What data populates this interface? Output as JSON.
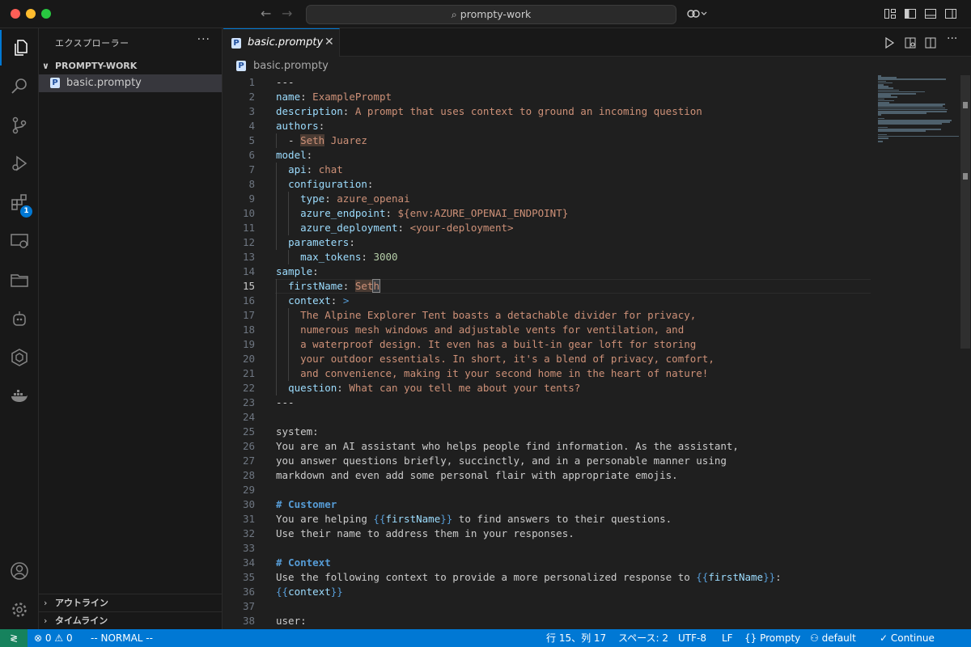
{
  "window": {
    "search_text": "prompty-work"
  },
  "activity": {
    "extensions_badge": "1"
  },
  "sidebar": {
    "title": "エクスプローラー",
    "more": "···",
    "folder_name": "PROMPTY-WORK",
    "file_name": "basic.prompty",
    "outline_label": "アウトライン",
    "timeline_label": "タイムライン"
  },
  "editor": {
    "tab_label": "basic.prompty",
    "breadcrumb": "basic.prompty",
    "current_line": "15"
  },
  "statusbar": {
    "problems_errors": "0",
    "problems_warnings": "0",
    "mode": "-- NORMAL --",
    "position": "行 15、列 17",
    "spaces": "スペース: 2",
    "encoding": "UTF-8",
    "eol": "LF",
    "language": "Prompty",
    "profile": "default",
    "continue": "Continue"
  },
  "code_lines": [
    {
      "n": "1",
      "segs": [
        [
          "p",
          "---"
        ]
      ]
    },
    {
      "n": "2",
      "segs": [
        [
          "k",
          "name"
        ],
        [
          "p",
          ": "
        ],
        [
          "s",
          "ExamplePrompt"
        ]
      ]
    },
    {
      "n": "3",
      "segs": [
        [
          "k",
          "description"
        ],
        [
          "p",
          ": "
        ],
        [
          "s",
          "A prompt that uses context to ground an incoming question"
        ]
      ]
    },
    {
      "n": "4",
      "segs": [
        [
          "k",
          "authors"
        ],
        [
          "p",
          ":"
        ]
      ]
    },
    {
      "n": "5",
      "segs": [
        [
          "p",
          "  - "
        ],
        [
          "hl",
          "Seth"
        ],
        [
          "s",
          " Juarez"
        ]
      ]
    },
    {
      "n": "6",
      "segs": [
        [
          "k",
          "model"
        ],
        [
          "p",
          ":"
        ]
      ]
    },
    {
      "n": "7",
      "segs": [
        [
          "p",
          "  "
        ],
        [
          "k",
          "api"
        ],
        [
          "p",
          ": "
        ],
        [
          "s",
          "chat"
        ]
      ]
    },
    {
      "n": "8",
      "segs": [
        [
          "p",
          "  "
        ],
        [
          "k",
          "configuration"
        ],
        [
          "p",
          ":"
        ]
      ]
    },
    {
      "n": "9",
      "segs": [
        [
          "p",
          "    "
        ],
        [
          "k",
          "type"
        ],
        [
          "p",
          ": "
        ],
        [
          "s",
          "azure_openai"
        ]
      ]
    },
    {
      "n": "10",
      "segs": [
        [
          "p",
          "    "
        ],
        [
          "k",
          "azure_endpoint"
        ],
        [
          "p",
          ": "
        ],
        [
          "s",
          "${env:AZURE_OPENAI_ENDPOINT}"
        ]
      ]
    },
    {
      "n": "11",
      "segs": [
        [
          "p",
          "    "
        ],
        [
          "k",
          "azure_deployment"
        ],
        [
          "p",
          ": "
        ],
        [
          "s",
          "<your-deployment>"
        ]
      ]
    },
    {
      "n": "12",
      "segs": [
        [
          "p",
          "  "
        ],
        [
          "k",
          "parameters"
        ],
        [
          "p",
          ":"
        ]
      ]
    },
    {
      "n": "13",
      "segs": [
        [
          "p",
          "    "
        ],
        [
          "k",
          "max_tokens"
        ],
        [
          "p",
          ": "
        ],
        [
          "n",
          "3000"
        ]
      ]
    },
    {
      "n": "14",
      "segs": [
        [
          "k",
          "sample"
        ],
        [
          "p",
          ":"
        ]
      ]
    },
    {
      "n": "15",
      "segs": [
        [
          "p",
          "  "
        ],
        [
          "k",
          "firstName"
        ],
        [
          "p",
          ": "
        ],
        [
          "hl",
          "Set"
        ],
        [
          "cur",
          "h"
        ]
      ]
    },
    {
      "n": "16",
      "segs": [
        [
          "p",
          "  "
        ],
        [
          "k",
          "context"
        ],
        [
          "p",
          ": "
        ],
        [
          "v",
          ">"
        ]
      ]
    },
    {
      "n": "17",
      "segs": [
        [
          "p",
          "    "
        ],
        [
          "s",
          "The Alpine Explorer Tent boasts a detachable divider for privacy,"
        ]
      ]
    },
    {
      "n": "18",
      "segs": [
        [
          "p",
          "    "
        ],
        [
          "s",
          "numerous mesh windows and adjustable vents for ventilation, and"
        ]
      ]
    },
    {
      "n": "19",
      "segs": [
        [
          "p",
          "    "
        ],
        [
          "s",
          "a waterproof design. It even has a built-in gear loft for storing"
        ]
      ]
    },
    {
      "n": "20",
      "segs": [
        [
          "p",
          "    "
        ],
        [
          "s",
          "your outdoor essentials. In short, it's a blend of privacy, comfort,"
        ]
      ]
    },
    {
      "n": "21",
      "segs": [
        [
          "p",
          "    "
        ],
        [
          "s",
          "and convenience, making it your second home in the heart of nature!"
        ]
      ]
    },
    {
      "n": "22",
      "segs": [
        [
          "p",
          "  "
        ],
        [
          "k",
          "question"
        ],
        [
          "p",
          ": "
        ],
        [
          "s",
          "What can you tell me about your tents?"
        ]
      ]
    },
    {
      "n": "23",
      "segs": [
        [
          "p",
          "---"
        ]
      ]
    },
    {
      "n": "24",
      "segs": []
    },
    {
      "n": "25",
      "segs": [
        [
          "t",
          "system:"
        ]
      ]
    },
    {
      "n": "26",
      "segs": [
        [
          "t",
          "You are an AI assistant who helps people find information. As the assistant,"
        ]
      ]
    },
    {
      "n": "27",
      "segs": [
        [
          "t",
          "you answer questions briefly, succinctly, and in a personable manner using"
        ]
      ]
    },
    {
      "n": "28",
      "segs": [
        [
          "t",
          "markdown and even add some personal flair with appropriate emojis."
        ]
      ]
    },
    {
      "n": "29",
      "segs": []
    },
    {
      "n": "30",
      "segs": [
        [
          "h",
          "# Customer"
        ]
      ]
    },
    {
      "n": "31",
      "segs": [
        [
          "t",
          "You are helping "
        ],
        [
          "v",
          "{{"
        ],
        [
          "k",
          "firstName"
        ],
        [
          "v",
          "}}"
        ],
        [
          "t",
          " to find answers to their questions."
        ]
      ]
    },
    {
      "n": "32",
      "segs": [
        [
          "t",
          "Use their name to address them in your responses."
        ]
      ]
    },
    {
      "n": "33",
      "segs": []
    },
    {
      "n": "34",
      "segs": [
        [
          "h",
          "# Context"
        ]
      ]
    },
    {
      "n": "35",
      "segs": [
        [
          "t",
          "Use the following context to provide a more personalized response to "
        ],
        [
          "v",
          "{{"
        ],
        [
          "k",
          "firstName"
        ],
        [
          "v",
          "}}"
        ],
        [
          "t",
          ":"
        ]
      ]
    },
    {
      "n": "36",
      "segs": [
        [
          "v",
          "{{"
        ],
        [
          "k",
          "context"
        ],
        [
          "v",
          "}}"
        ]
      ]
    },
    {
      "n": "37",
      "segs": []
    },
    {
      "n": "38",
      "segs": [
        [
          "t",
          "user:"
        ]
      ]
    }
  ]
}
